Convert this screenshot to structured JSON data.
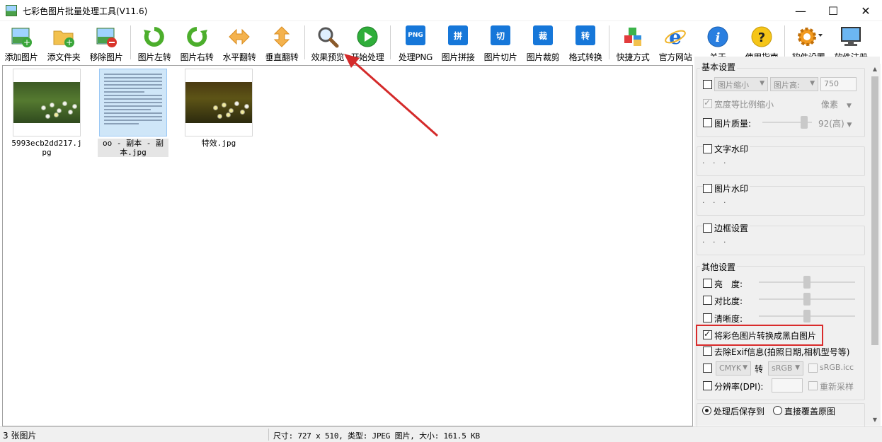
{
  "window": {
    "title": "七彩色图片批量处理工具(V11.6)",
    "min_icon": "minimize-icon",
    "max_icon": "maximize-icon",
    "close_icon": "close-icon"
  },
  "toolbar": {
    "items": [
      {
        "label": "添加图片",
        "icon": "add-image-icon"
      },
      {
        "label": "添文件夹",
        "icon": "add-folder-icon"
      },
      {
        "label": "移除图片",
        "icon": "remove-image-icon"
      },
      {
        "label": "图片左转",
        "icon": "rotate-left-icon"
      },
      {
        "label": "图片右转",
        "icon": "rotate-right-icon"
      },
      {
        "label": "水平翻转",
        "icon": "flip-horizontal-icon"
      },
      {
        "label": "垂直翻转",
        "icon": "flip-vertical-icon"
      },
      {
        "label": "效果预览",
        "icon": "magnifier-icon"
      },
      {
        "label": "开始处理",
        "icon": "play-icon"
      },
      {
        "label": "处理PNG",
        "icon": "png-icon",
        "glyph": "PNG"
      },
      {
        "label": "图片拼接",
        "icon": "stitch-icon",
        "glyph": "拼"
      },
      {
        "label": "图片切片",
        "icon": "slice-icon",
        "glyph": "切"
      },
      {
        "label": "图片裁剪",
        "icon": "crop-icon",
        "glyph": "裁"
      },
      {
        "label": "格式转换",
        "icon": "convert-icon",
        "glyph": "转"
      },
      {
        "label": "快捷方式",
        "icon": "shortcut-icon"
      },
      {
        "label": "官方网站",
        "icon": "ie-browser-icon"
      },
      {
        "label": "关于",
        "icon": "info-icon"
      },
      {
        "label": "使用指南",
        "icon": "help-icon"
      },
      {
        "label": "软件设置",
        "icon": "gear-icon"
      },
      {
        "label": "软件注册",
        "icon": "monitor-icon"
      }
    ]
  },
  "images": [
    {
      "caption": "5993ecb2dd217.jpg"
    },
    {
      "caption": "oo - 副本 - 副本.jpg"
    },
    {
      "caption": "特效.jpg"
    }
  ],
  "panel": {
    "basic": {
      "title": "基本设置",
      "resize_label": "图片缩小",
      "height_label": "图片高:",
      "height_value": "750",
      "keep_ratio": "宽度等比例缩小",
      "unit": "像素",
      "quality_label": "图片质量:",
      "quality_value": "92(高)"
    },
    "text_watermark": {
      "title": "文字水印",
      "dots": "· · ·"
    },
    "image_watermark": {
      "title": "图片水印",
      "dots": "· · ·"
    },
    "border": {
      "title": "边框设置",
      "dots": "· · ·"
    },
    "other": {
      "title": "其他设置",
      "brightness": "亮　度:",
      "contrast": "对比度:",
      "sharpness": "清晰度:",
      "grayscale": "将彩色图片转换成黑白图片",
      "remove_exif": "去除Exif信息(拍照日期,相机型号等)",
      "cmyk": "CMYK",
      "to": "转",
      "srgb": "sRGB",
      "srgb_icc": "sRGB.icc",
      "dpi": "分辨率(DPI):",
      "resample": "重新采样"
    },
    "output": {
      "save_to": "处理后保存到",
      "overwrite": "直接覆盖原图"
    }
  },
  "status": {
    "count": "3 张图片",
    "info": "尺寸: 727 x 510, 类型: JPEG 图片, 大小: 161.5 KB"
  },
  "colors": {
    "accent_blue": "#1677d9",
    "highlight_red": "#d92b2b",
    "arrow_red": "#d42a2a"
  }
}
